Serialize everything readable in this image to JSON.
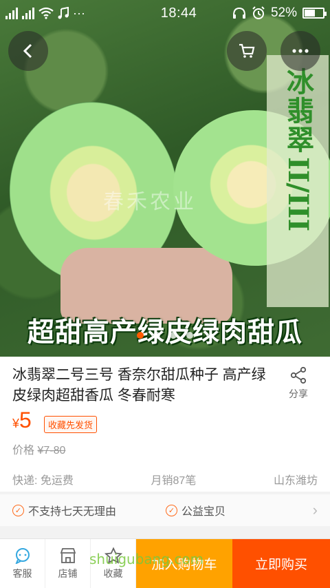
{
  "status_bar": {
    "time": "18:44",
    "battery_percent": "52%",
    "battery_level": 0.52,
    "icons": [
      "signal-icon",
      "signal-icon",
      "wifi-icon",
      "music-icon",
      "more-icon",
      "headphones-icon",
      "alarm-icon",
      "battery-icon"
    ]
  },
  "hero": {
    "watermark": "春禾农业",
    "vertical_title": "冰翡翠",
    "vertical_numerals": "II/III",
    "banner": "超甜高产绿皮绿肉甜瓜",
    "slide_count": 4,
    "active_slide": 0
  },
  "nav": {
    "back_icon": "chevron-left-icon",
    "cart_icon": "cart-icon",
    "more_icon": "more-dots-icon"
  },
  "product": {
    "title": "冰翡翠二号三号 香奈尔甜瓜种子 高产绿皮绿肉超甜香瓜  冬春耐寒",
    "share_label": "分享",
    "price_symbol": "¥",
    "price": "5",
    "badge": "收藏先发货",
    "original_price_label": "价格",
    "original_price": "¥7-80",
    "shipping": "快递: 免运费",
    "monthly_sales": "月销87笔",
    "location": "山东潍坊"
  },
  "services": {
    "item1": "不支持七天无理由",
    "item2": "公益宝贝"
  },
  "bottom_bar": {
    "service_label": "客服",
    "shop_label": "店铺",
    "favorite_label": "收藏",
    "add_to_cart": "加入购物车",
    "buy_now": "立即购买"
  },
  "site_watermark": "shuigubang.com",
  "colors": {
    "accent": "#ff5000",
    "cart_button": "#ffa200",
    "check_icon": "#ff6a1a"
  }
}
